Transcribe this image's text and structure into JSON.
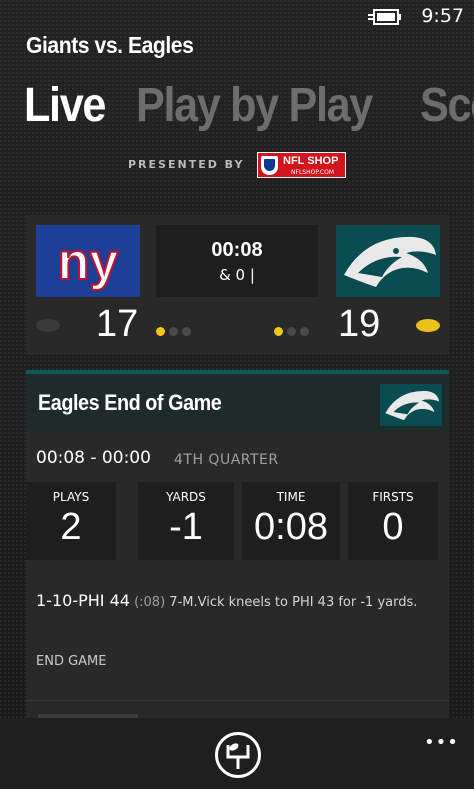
{
  "status_bar": {
    "time": "9:57"
  },
  "header": {
    "title": "Giants vs. Eagles",
    "pivots": [
      "Live",
      "Play by Play",
      "Scori"
    ]
  },
  "sponsor": {
    "label": "PRESENTED BY",
    "badge_text": "NFL SHOP",
    "badge_url": "NFLSHOP.COM"
  },
  "scoreboard": {
    "game_clock": "00:08",
    "down_distance": "& 0 |",
    "home_score": "17",
    "away_score": "19",
    "home_timeouts_left": 1,
    "away_timeouts_left": 1,
    "timeouts_total": 3,
    "possession": "away",
    "colors": {
      "giants_blue": "#1d3f95",
      "eagles_green": "#0b4b52",
      "timeout_yellow": "#f3c71c"
    }
  },
  "drive": {
    "title": "Eagles End of Game",
    "time_range": "00:08 - 00:00",
    "quarter": "4TH QUARTER",
    "stats": [
      {
        "label": "PLAYS",
        "value": "2"
      },
      {
        "label": "YARDS",
        "value": "-1"
      },
      {
        "label": "TIME",
        "value": "0:08"
      },
      {
        "label": "FIRSTS",
        "value": "0"
      }
    ],
    "play": {
      "situation": "1-10-PHI 44",
      "time": "(:08)",
      "description": "7-M.Vick kneels to PHI 43 for -1 yards."
    },
    "end_label": "END GAME"
  },
  "app_bar": {
    "more": "•••"
  }
}
